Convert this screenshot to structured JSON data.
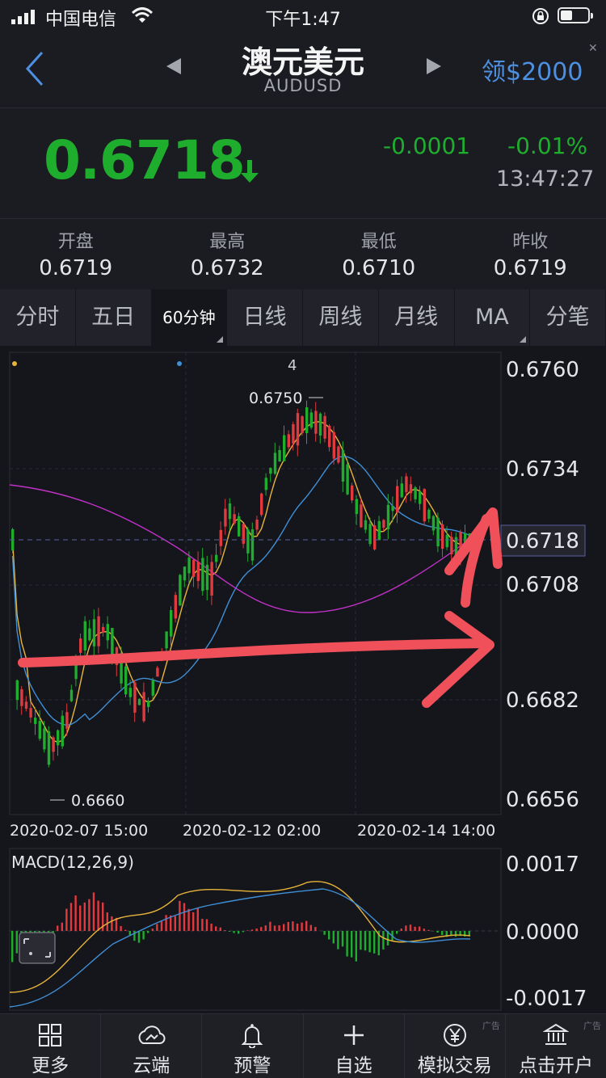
{
  "status_bar": {
    "carrier": "中国电信",
    "time": "下午1:47"
  },
  "nav": {
    "title": "澳元美元",
    "subtitle": "AUDUSD",
    "promo": "领$2000",
    "icons": [
      "back-icon",
      "prev-arrow-icon",
      "next-arrow-icon"
    ]
  },
  "quote": {
    "price": "0.6718",
    "change": "-0.0001",
    "change_pct": "-0.01%",
    "time": "13:47:27",
    "down_color": "#1fad2e"
  },
  "stats": [
    {
      "label": "开盘",
      "value": "0.6719"
    },
    {
      "label": "最高",
      "value": "0.6732"
    },
    {
      "label": "最低",
      "value": "0.6710"
    },
    {
      "label": "昨收",
      "value": "0.6719"
    }
  ],
  "tabs": [
    {
      "label": "分时"
    },
    {
      "label": "五日"
    },
    {
      "label": "60分钟",
      "active": true
    },
    {
      "label": "日线"
    },
    {
      "label": "周线"
    },
    {
      "label": "月线"
    },
    {
      "label": "MA"
    },
    {
      "label": "分笔"
    }
  ],
  "chart": {
    "top_marker": "4",
    "high_label": "0.6750",
    "low_label": "0.6660",
    "current_label": "0.6718",
    "x_labels": [
      "2020-02-07 15:00",
      "2020-02-12 02:00",
      "2020-02-14 14:00"
    ],
    "y_labels": [
      "0.6760",
      "0.6734",
      "0.6718",
      "0.6708",
      "0.6682",
      "0.6656"
    ],
    "macd_title": "MACD(12,26,9)",
    "macd_y_labels": [
      "0.0017",
      "0.0000",
      "-0.0017"
    ],
    "colors": {
      "up": "#e0393e",
      "down": "#1fad2e",
      "ma_fast": "#e8b43a",
      "ma_mid": "#3f8fd6",
      "ma_slow": "#c231c7",
      "annotation": "#f0505a"
    }
  },
  "bottom_nav": [
    {
      "label": "更多",
      "icon": "grid-icon"
    },
    {
      "label": "云端",
      "icon": "cloud-icon"
    },
    {
      "label": "预警",
      "icon": "bell-icon"
    },
    {
      "label": "自选",
      "icon": "plus-icon"
    },
    {
      "label": "模拟交易",
      "icon": "yen-icon",
      "ad": "广告"
    },
    {
      "label": "点击开户",
      "icon": "bank-icon",
      "ad": "广告"
    }
  ]
}
